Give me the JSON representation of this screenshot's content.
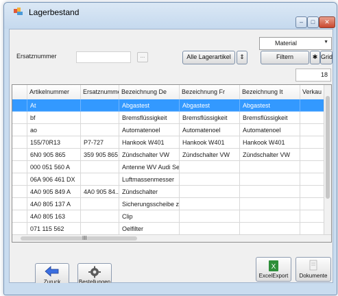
{
  "window": {
    "title": "Lagerbestand"
  },
  "toolbar": {
    "combo_value": "Material",
    "ersatz_label": "Ersatznummer",
    "ersatz_value": "",
    "dots_label": "...",
    "all_label": "Alle Lagerartikel",
    "sort_label": "⇕",
    "filter_label": "Filtern",
    "star_label": "✱",
    "grid_label": "Grid",
    "count": "18"
  },
  "grid": {
    "columns": [
      "Artikelnummer",
      "Ersatznummer",
      "Bezeichnung De",
      "Bezeichnung Fr",
      "Bezeichnung It",
      "Verkau"
    ],
    "rows": [
      [
        "At",
        "",
        "Abgastest",
        "Abgastest",
        "Abgastest",
        ""
      ],
      [
        "bf",
        "",
        "Bremsflüssigkeit",
        "Bremsflüssigkeit",
        "Bremsflüssigkeit",
        ""
      ],
      [
        "ao",
        "",
        "Automatenoel",
        "Automatenoel",
        "Automatenoel",
        ""
      ],
      [
        "155/70R13",
        "P7-727",
        "Hankook W401",
        "Hankook W401",
        "Hankook W401",
        ""
      ],
      [
        "6N0 905 865",
        "359 905 865",
        "Zündschalter VW",
        "Zündschalter VW",
        "Zündschalter VW",
        ""
      ],
      [
        "000 051 560 A",
        "",
        "Antenne WV Audi Se...",
        "",
        "",
        ""
      ],
      [
        "06A 906 461 DX",
        "",
        "Luftmassenmesser",
        "",
        "",
        ""
      ],
      [
        "4A0 905 849 A",
        "4A0 905 84...",
        "Zündschalter",
        "",
        "",
        ""
      ],
      [
        "4A0 805 137 A",
        "",
        "Sicherungsscheibe z...",
        "",
        "",
        ""
      ],
      [
        "4A0 805 163",
        "",
        "Clip",
        "",
        "",
        ""
      ],
      [
        "071 115 562",
        "",
        "Oelfilter",
        "",
        "",
        ""
      ]
    ],
    "scroll_grip": "III"
  },
  "buttons": {
    "zuruck": "Zuruck",
    "bestellungen": "Bestellungen",
    "excel": "ExcelExport",
    "dokumente": "Dokumente"
  },
  "colors": {
    "selection": "#3399ff",
    "window_frame": "#c9dcef"
  }
}
